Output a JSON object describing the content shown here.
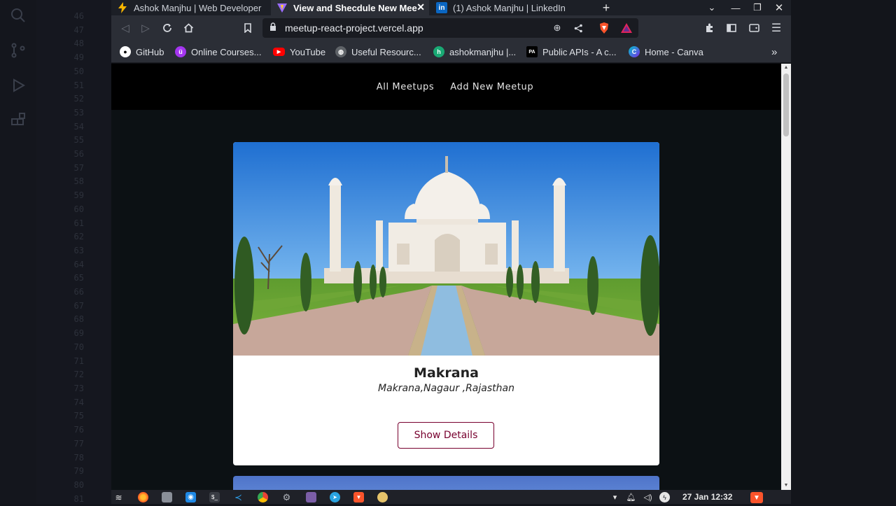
{
  "editor": {
    "line_numbers": [
      "46",
      "47",
      "48",
      "49",
      "50",
      "51",
      "52",
      "53",
      "54",
      "55",
      "56",
      "57",
      "58",
      "59",
      "60",
      "61",
      "62",
      "63",
      "64",
      "65",
      "66",
      "67",
      "68",
      "69",
      "70",
      "71",
      "72",
      "73",
      "74",
      "75",
      "76",
      "77",
      "78",
      "79",
      "80",
      "81"
    ]
  },
  "tabs": [
    {
      "label": "Ashok Manjhu | Web Developer",
      "icon": "bolt-icon"
    },
    {
      "label": "View and Shecdule New Mee",
      "icon": "vite-icon",
      "active": true
    },
    {
      "label": "(1) Ashok Manjhu | LinkedIn",
      "icon": "linkedin-icon"
    }
  ],
  "new_tab_label": "+",
  "address_bar": {
    "url": "meetup-react-project.vercel.app"
  },
  "bookmarks": [
    {
      "label": "GitHub",
      "icon": "github-icon",
      "color": "#2b2e36"
    },
    {
      "label": "Online Courses...",
      "icon": "udemy-icon",
      "color": "#a435f0"
    },
    {
      "label": "YouTube",
      "icon": "youtube-icon",
      "color": "#ff0000"
    },
    {
      "label": "Useful Resourc...",
      "icon": "globe-icon",
      "color": "#5f6368"
    },
    {
      "label": "ashokmanjhu |...",
      "icon": "hashnode-icon",
      "color": "#19a974"
    },
    {
      "label": "Public APIs - A c...",
      "icon": "pa-icon",
      "color": "#000000"
    },
    {
      "label": "Home - Canva",
      "icon": "canva-icon",
      "color": "#7d2ae8"
    }
  ],
  "bookmark_overflow": "»",
  "nav": {
    "all_meetups": "All Meetups",
    "add_meetup": "Add New Meetup"
  },
  "meetup": {
    "title": "Makrana",
    "address": "Makrana,Nagaur ,Rajasthan",
    "button_label": "Show Details"
  },
  "taskbar": {
    "clock": "27 Jan 12:32"
  },
  "colors": {
    "accent": "#77002e",
    "header_bg": "#000000",
    "page_bg": "#0c1114"
  }
}
